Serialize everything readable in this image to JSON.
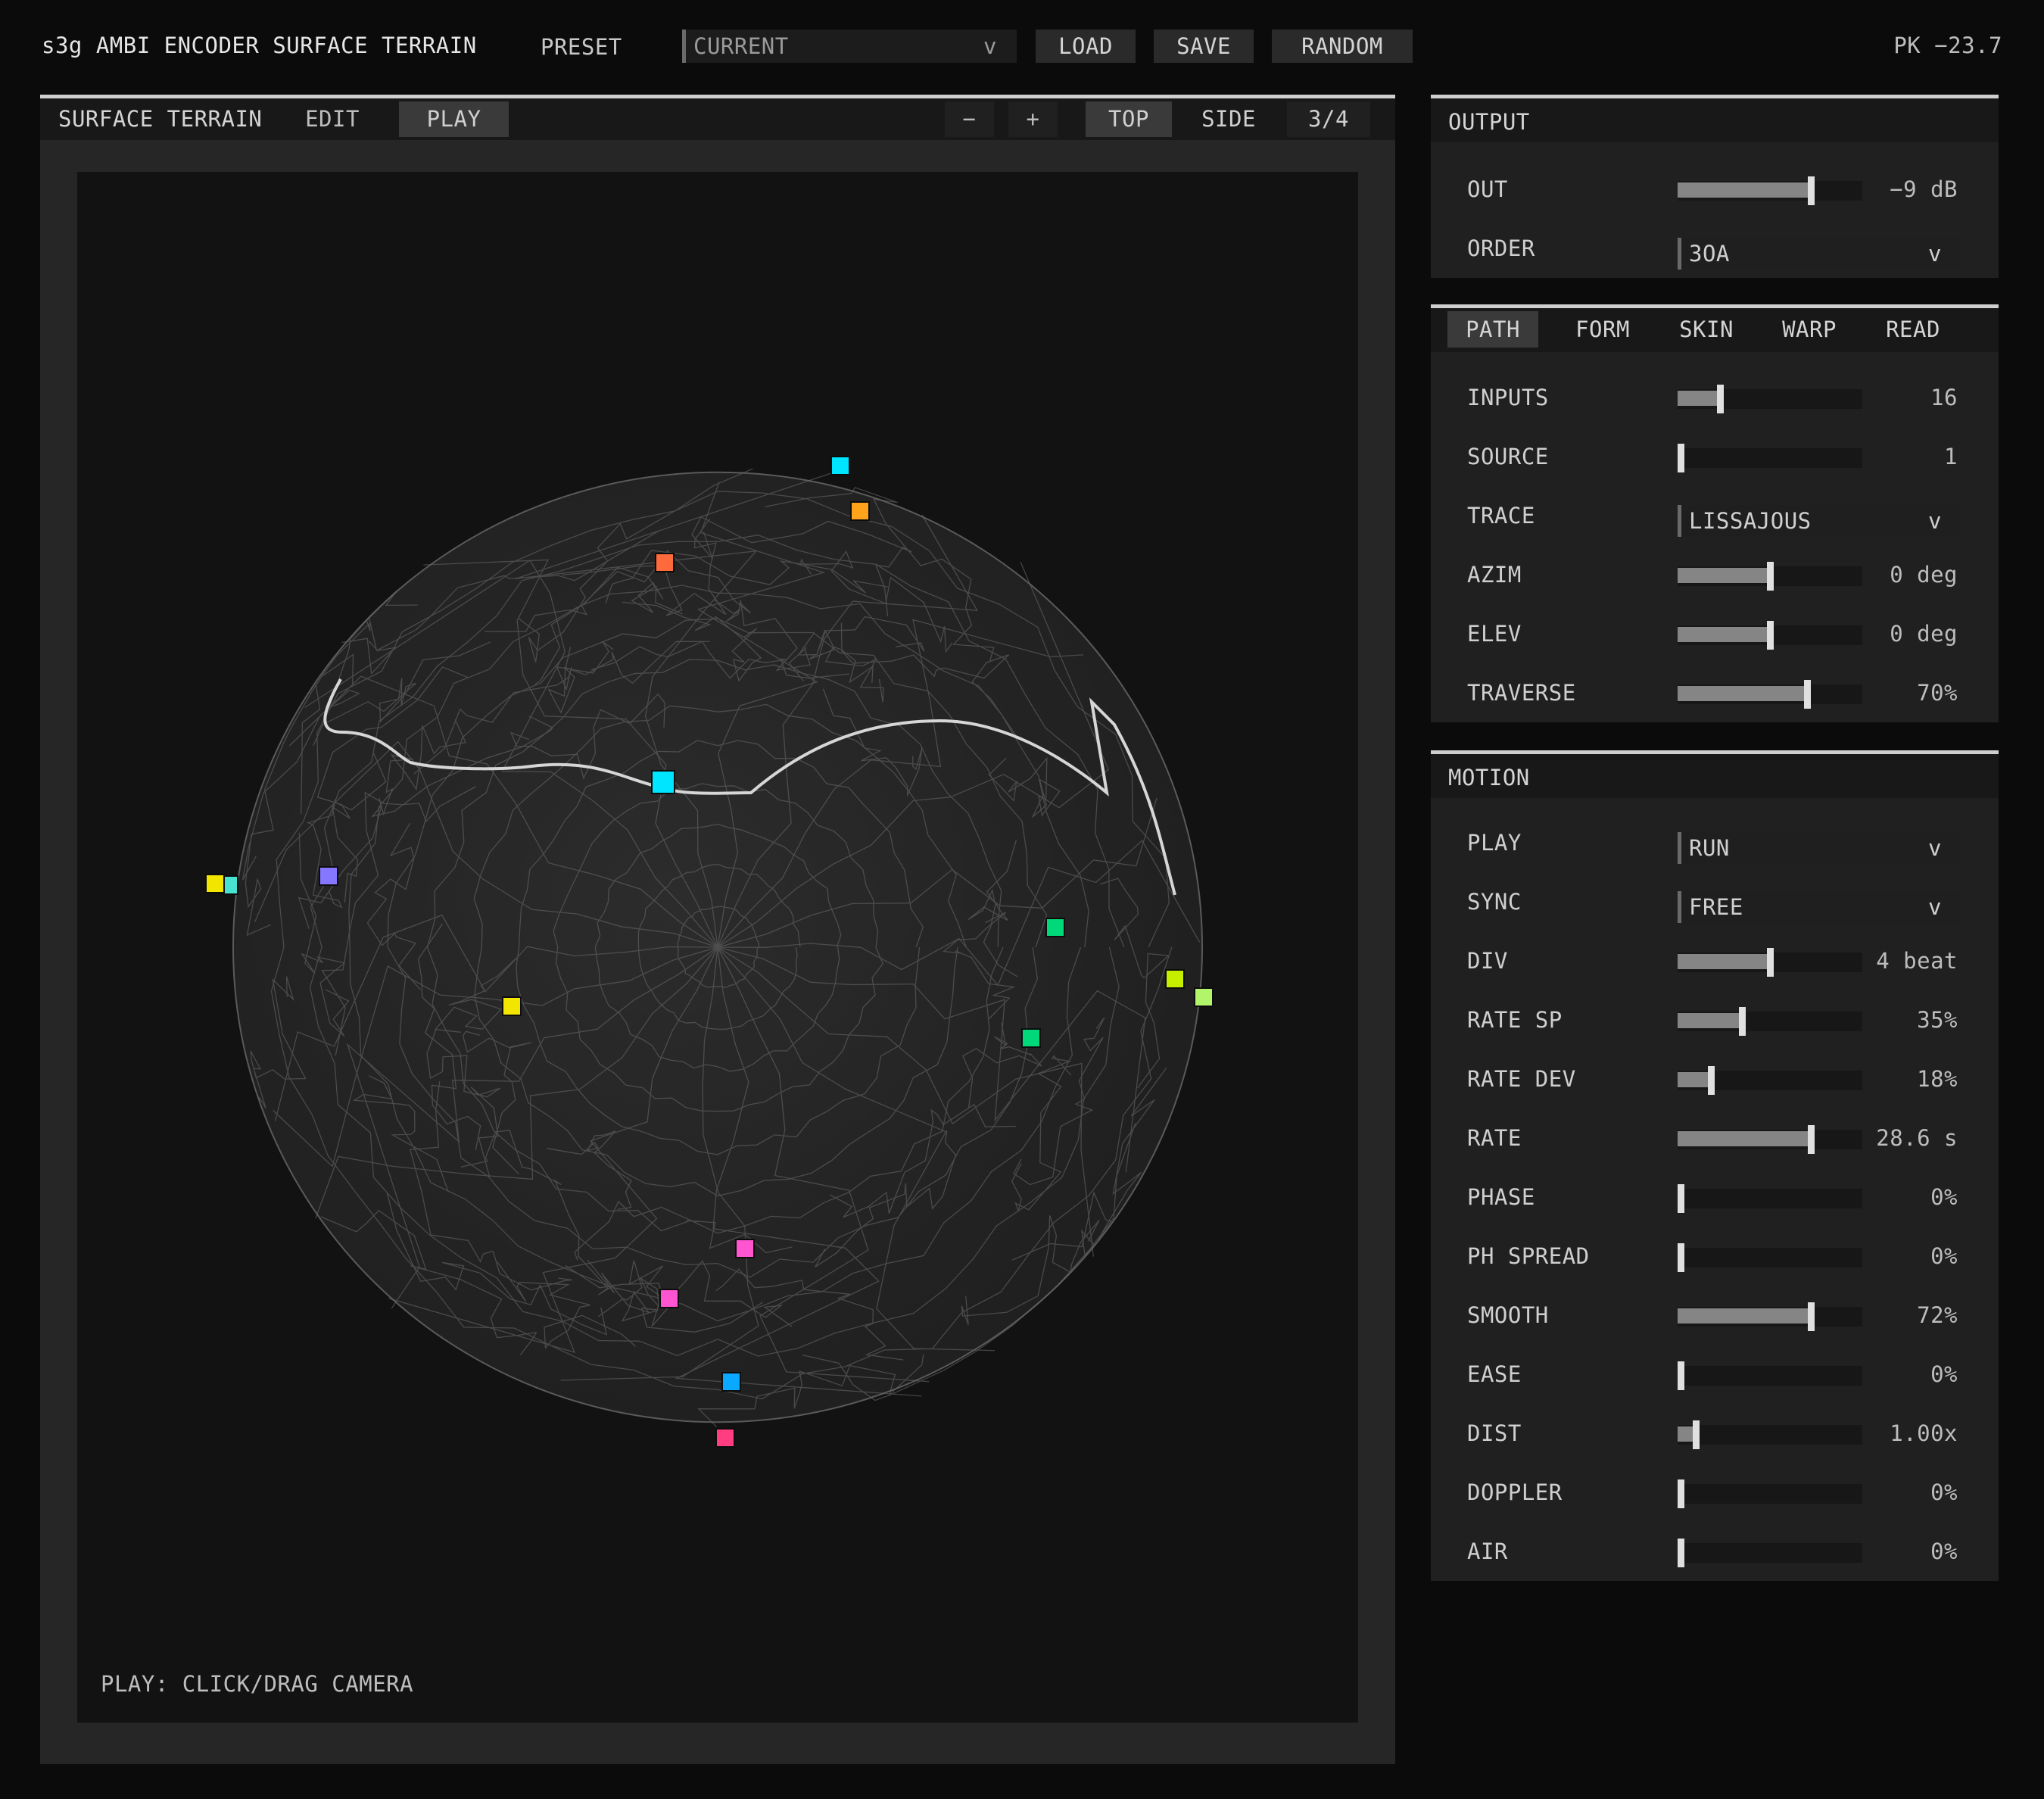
{
  "app": {
    "title": "s3g AMBI ENCODER SURFACE TERRAIN",
    "preset_label": "PRESET",
    "preset_value": "CURRENT",
    "load": "LOAD",
    "save": "SAVE",
    "random": "RANDOM",
    "peak": "PK −23.7"
  },
  "view": {
    "title": "SURFACE TERRAIN",
    "tabs": [
      "EDIT",
      "PLAY"
    ],
    "active_tab": "PLAY",
    "zoom_out": "−",
    "zoom_in": "+",
    "views": [
      "TOP",
      "SIDE",
      "3/4"
    ],
    "active_view": "TOP",
    "hint": "PLAY: CLICK/DRAG CAMERA",
    "source_colors": [
      "#ff6a3d",
      "#00e5ff",
      "#ffa31a",
      "#00e5ff",
      "#8577ff",
      "#f2e600",
      "#48e3d0",
      "#f2e600",
      "#00d87a",
      "#00d87a",
      "#c6ef00",
      "#b3f56a",
      "#ff55d0",
      "#ff55d0",
      "#0aa8ff",
      "#ff3d80"
    ]
  },
  "output": {
    "title": "OUTPUT",
    "rows": [
      {
        "label": "OUT",
        "type": "slider",
        "level": 0.72,
        "value": "−9 dB"
      },
      {
        "label": "ORDER",
        "type": "select",
        "value": "3OA"
      }
    ]
  },
  "path": {
    "tabs": [
      "PATH",
      "FORM",
      "SKIN",
      "WARP",
      "READ"
    ],
    "active_tab": "PATH",
    "rows": [
      {
        "label": "INPUTS",
        "type": "slider",
        "level": 0.23,
        "value": "16"
      },
      {
        "label": "SOURCE",
        "type": "slider",
        "level": 0.0,
        "value": "1"
      },
      {
        "label": "TRACE",
        "type": "select",
        "value": "LISSAJOUS"
      },
      {
        "label": "AZIM",
        "type": "slider",
        "level": 0.5,
        "value": "0 deg"
      },
      {
        "label": "ELEV",
        "type": "slider",
        "level": 0.5,
        "value": "0 deg"
      },
      {
        "label": "TRAVERSE",
        "type": "slider",
        "level": 0.7,
        "value": "70%"
      }
    ]
  },
  "motion": {
    "title": "MOTION",
    "rows": [
      {
        "label": "PLAY",
        "type": "select",
        "value": "RUN"
      },
      {
        "label": "SYNC",
        "type": "select",
        "value": "FREE"
      },
      {
        "label": "DIV",
        "type": "slider",
        "level": 0.5,
        "value": "4 beat"
      },
      {
        "label": "RATE SP",
        "type": "slider",
        "level": 0.35,
        "value": "35%"
      },
      {
        "label": "RATE DEV",
        "type": "slider",
        "level": 0.18,
        "value": "18%"
      },
      {
        "label": "RATE",
        "type": "slider",
        "level": 0.72,
        "value": "28.6 s"
      },
      {
        "label": "PHASE",
        "type": "slider",
        "level": 0.0,
        "value": "0%"
      },
      {
        "label": "PH SPREAD",
        "type": "slider",
        "level": 0.0,
        "value": "0%"
      },
      {
        "label": "SMOOTH",
        "type": "slider",
        "level": 0.72,
        "value": "72%"
      },
      {
        "label": "EASE",
        "type": "slider",
        "level": 0.0,
        "value": "0%"
      },
      {
        "label": "DIST",
        "type": "slider",
        "level": 0.1,
        "value": "1.00x"
      },
      {
        "label": "DOPPLER",
        "type": "slider",
        "level": 0.0,
        "value": "0%"
      },
      {
        "label": "AIR",
        "type": "slider",
        "level": 0.0,
        "value": "0%"
      }
    ]
  }
}
